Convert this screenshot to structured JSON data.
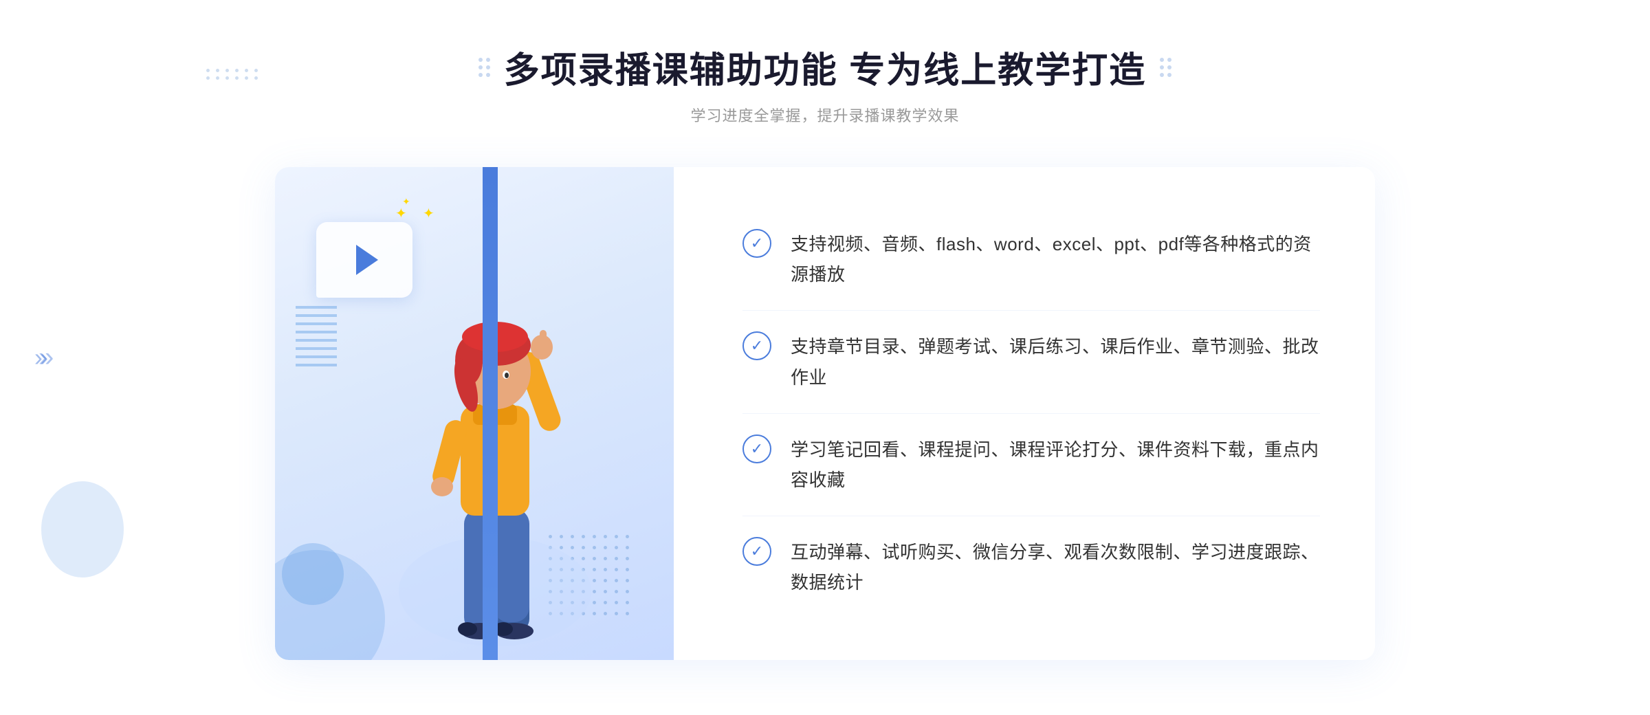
{
  "header": {
    "title": "多项录播课辅助功能 专为线上教学打造",
    "subtitle": "学习进度全掌握，提升录播课教学效果"
  },
  "decorations": {
    "left_chevron": "»"
  },
  "features": [
    {
      "id": "feature-1",
      "text": "支持视频、音频、flash、word、excel、ppt、pdf等各种格式的资源播放"
    },
    {
      "id": "feature-2",
      "text": "支持章节目录、弹题考试、课后练习、课后作业、章节测验、批改作业"
    },
    {
      "id": "feature-3",
      "text": "学习笔记回看、课程提问、课程评论打分、课件资料下载，重点内容收藏"
    },
    {
      "id": "feature-4",
      "text": "互动弹幕、试听购买、微信分享、观看次数限制、学习进度跟踪、数据统计"
    }
  ],
  "colors": {
    "primary": "#4a7cdc",
    "text_dark": "#1a1a2e",
    "text_light": "#999999",
    "text_body": "#333333",
    "bg_illustration": "#dce9fc",
    "border": "#f0f4fc"
  }
}
